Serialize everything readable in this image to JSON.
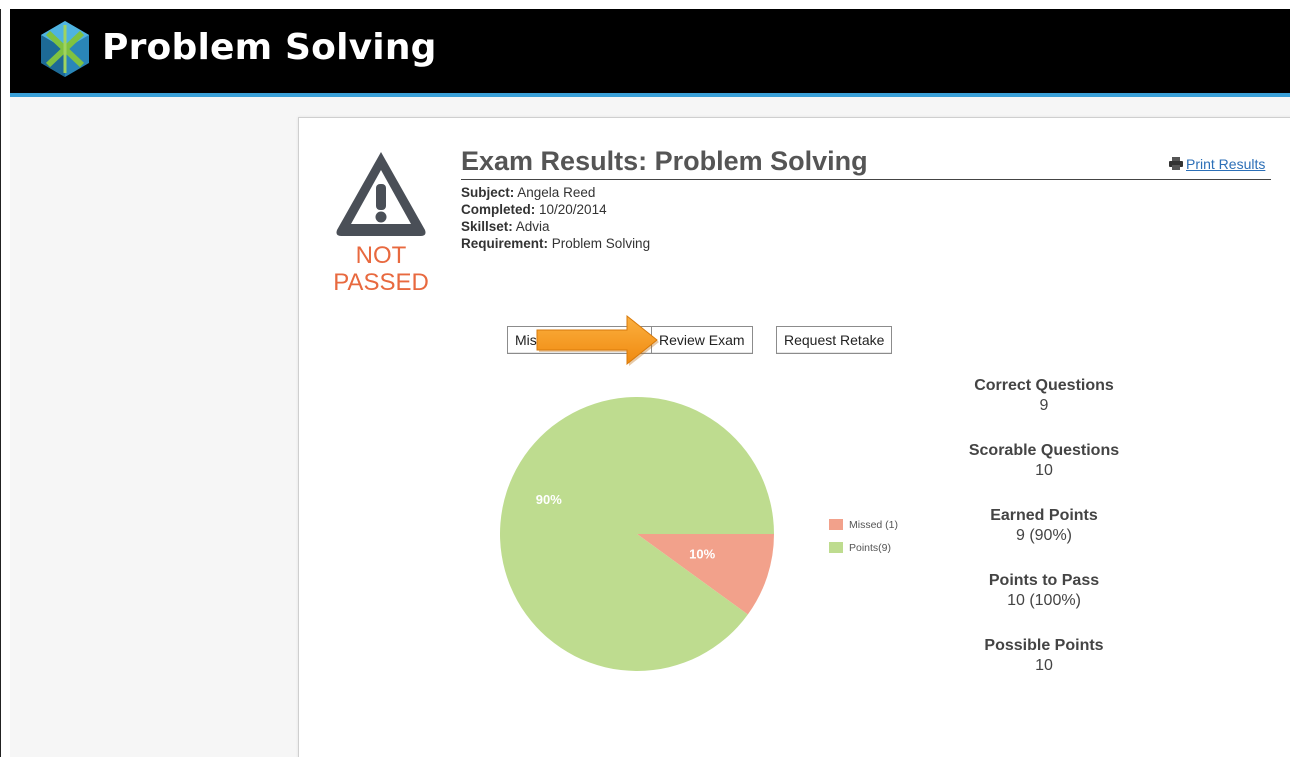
{
  "app": {
    "title": "Problem Solving"
  },
  "status": {
    "line1": "NOT",
    "line2": "PASSED",
    "color": "#e8693f"
  },
  "results": {
    "title": "Exam Results: Problem Solving",
    "print_label": "Print Results",
    "meta": [
      {
        "label": "Subject:",
        "value": "Angela Reed"
      },
      {
        "label": "Completed:",
        "value": "10/20/2014"
      },
      {
        "label": "Skillset:",
        "value": "Advia"
      },
      {
        "label": "Requirement:",
        "value": "Problem Solving"
      }
    ]
  },
  "buttons": {
    "missed_label": "Missed",
    "missed_visible": "Mis",
    "review_label": "Review Exam",
    "retake_label": "Request Retake"
  },
  "chart_data": {
    "type": "pie",
    "slices": [
      {
        "name": "Missed (1)",
        "value": 10,
        "label": "10%",
        "color": "#f2a18b"
      },
      {
        "name": "Points(9)",
        "value": 90,
        "label": "90%",
        "color": "#bedc8f"
      }
    ]
  },
  "stats": [
    {
      "label": "Correct Questions",
      "value": "9"
    },
    {
      "label": "Scorable Questions",
      "value": "10"
    },
    {
      "label": "Earned Points",
      "value": "9 (90%)"
    },
    {
      "label": "Points to Pass",
      "value": "10 (100%)"
    },
    {
      "label": "Possible Points",
      "value": "10"
    }
  ],
  "colors": {
    "accent": "#3aa0d8",
    "arrow": "#f7941d",
    "link": "#2c6fb7"
  }
}
